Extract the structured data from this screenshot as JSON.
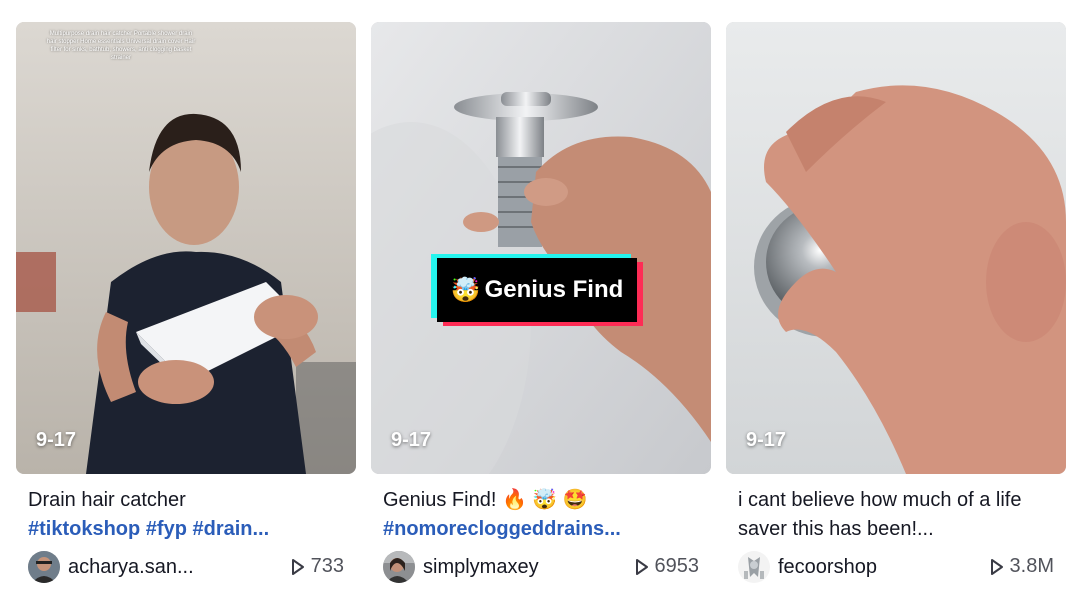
{
  "videos": [
    {
      "date": "9-17",
      "overlay_text": "Multipurpose drain hair catcher Portable shower drain hair stopper Home essentials Universal drain cover Hair filter for sinks, bathtub, showers, anti clogging basket strainer",
      "caption_text": "Drain hair catcher",
      "hashtags": "#tiktokshop #fyp #drain...",
      "author": "acharya.san...",
      "views": "733"
    },
    {
      "date": "9-17",
      "badge_text": "Genius Find",
      "badge_emoji": "🤯",
      "caption_text": "Genius Find! 🔥 🤯 🤩",
      "hashtags": "#nomorecloggeddrains...",
      "author": "simplymaxey",
      "views": "6953"
    },
    {
      "date": "9-17",
      "caption_text": "i cant believe how much of a life saver this has been!...",
      "author": "fecoorshop",
      "views": "3.8M"
    }
  ],
  "colors": {
    "hashtag": "#2b5db9",
    "badge_cyan": "#25f4ee",
    "badge_red": "#fe2c55"
  }
}
